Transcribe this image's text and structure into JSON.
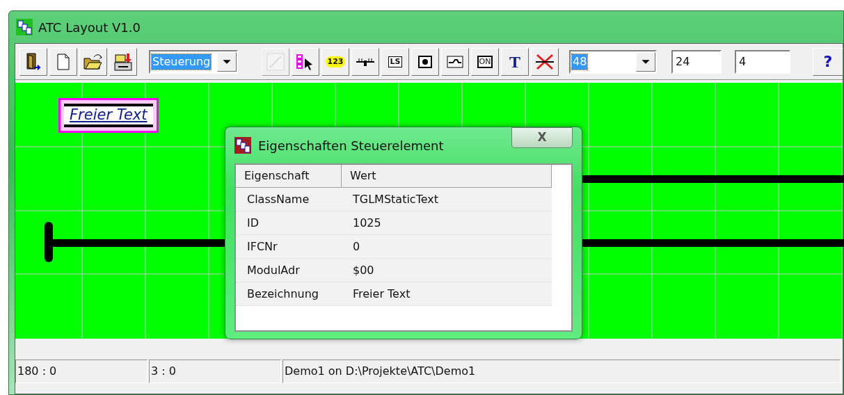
{
  "window": {
    "title": "ATC Layout V1.0"
  },
  "toolbar": {
    "file_buttons": [
      {
        "kind": "exit"
      },
      {
        "kind": "new"
      },
      {
        "kind": "open"
      },
      {
        "kind": "save"
      }
    ],
    "mode_select": {
      "value": "Steuerung"
    },
    "tools": [
      {
        "kind": "blank",
        "disabled": true
      },
      {
        "kind": "select",
        "disabled": false
      },
      {
        "kind": "counter",
        "label": "123",
        "disabled": false
      },
      {
        "kind": "track",
        "disabled": false
      },
      {
        "kind": "signal",
        "label": "LS",
        "disabled": false
      },
      {
        "kind": "push",
        "disabled": false
      },
      {
        "kind": "switch",
        "disabled": false
      },
      {
        "kind": "on",
        "label": "ON",
        "disabled": false
      },
      {
        "kind": "text",
        "label": "T",
        "disabled": false
      },
      {
        "kind": "delete",
        "disabled": false
      }
    ],
    "size_select": {
      "value": "48"
    },
    "grid_field": {
      "value": "24"
    },
    "step_field": {
      "value": "4"
    },
    "help": {
      "label": "?"
    }
  },
  "canvas": {
    "text_element": {
      "text": "Freier Text",
      "selected": true
    }
  },
  "dialog": {
    "title": "Eigenschaften Steuerelement",
    "close": "X",
    "columns": [
      "Eigenschaft",
      "Wert"
    ],
    "rows": [
      {
        "name": "ClassName",
        "value": "TGLMStaticText"
      },
      {
        "name": "ID",
        "value": "1025"
      },
      {
        "name": "IFCNr",
        "value": "0"
      },
      {
        "name": "ModulAdr",
        "value": "$00"
      },
      {
        "name": "Bezeichnung",
        "value": "Freier Text"
      }
    ]
  },
  "status_bar": [
    "180 : 0",
    "3 : 0",
    "Demo1 on D:\\Projekte\\ATC\\Demo1"
  ]
}
